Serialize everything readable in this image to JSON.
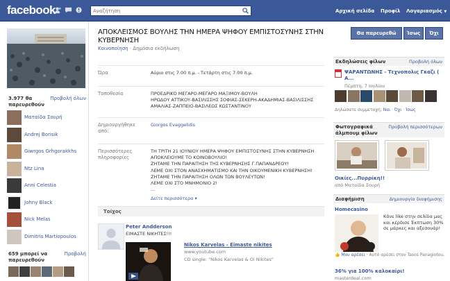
{
  "header": {
    "logo": "facebook",
    "search_placeholder": "Αναζήτηση",
    "nav_home": "Αρχική σελίδα",
    "nav_profile": "Προφίλ",
    "nav_account": "Λογαριασμός",
    "account_caret": "▼"
  },
  "left": {
    "attending_count": "3.977 θα παρευρεθούν",
    "see_all": "Προβολή όλων",
    "people": [
      "Ματαίδα Σουρή",
      "Andrej Borisik",
      "Giwrgos Grhgorakkhs",
      "Ntz Lina",
      "Anni Celestia",
      "Johny Black",
      "Nick Melas",
      "Dimitris Martiopoulos"
    ],
    "maybe_count": "659 μπορεί να παρευρεθούν",
    "maybe_see_all": "Προβολή"
  },
  "event": {
    "title": "ΑΠΟΚΛΕΙΣΜΟΣ ΒΟΥΛΗΣ ΤΗΝ ΗΜΕΡΑ ΨΗΦΟΥ ΕΜΠΙΣΤΟΣΥΝΗΣ ΣΤΗΝ ΚΥΒΕΡΝΗΣΗ",
    "share": "Κοινοποίηση",
    "privacy": " · Δημόσια εκδήλωση",
    "time_label": "Ώρα",
    "time_value": "Αύριο στις 7:00 π.μ. - Τετάρτη στις 7:00 π.μ.",
    "place_label": "Τοποθεσία",
    "place_value": "ΠΡΟΕΔΡΙΚΟ ΜΕΓΑΡΟ-ΜΕΓΑΡΟ ΜΑΞΙΜΟΥ-ΒΟΥΛΗ\nΗΡΩΔΟΥ ΑΤΤΙΚΟΥ-ΒΑΣΙΛΙΣΣΗΣ ΣΟΦΙΑΣ-ΣΕΚΕΡΗ-ΑΚΑΔΗΜΙΑΣ-ΒΑΣΙΛΙΣΣΗΣ\nΑΜΑΛΙΑΣ-ΖΑΠΠΕΙΟ-ΒΑΣΙΛΕΩΣ ΚΩΣΤΑΝΤΙΝΟΥ",
    "created_label": "Δημιουργήθηκε από:",
    "created_value": "Giorgos Evaggelidis",
    "more_label": "Περισσότερες πληροφορίες",
    "more_value": "ΤΗ ΤΡΙΤΗ 21 ΙΟΥΝΙΟΥ ΗΜΕΡΑ ΨΗΦΟΥ ΕΜΠΙΣΤΟΣΥΝΗΣ ΣΤΗΝ ΚΥΒΕΡΝΗΣΗ\nΑΠΟΚΛΕΙΟΥΜΕ ΤΟ ΚΟΙΝΟΒΟΥΛΙΟ!\nΖΗΤΑΜΕ ΤΗΝ ΠΑΡΑΙΤΗΣΗ ΤΗΣ ΚΥΒΕΡΝΗΣΗΣ Γ.ΠΑΠΑΝΔΡΕΟΥ!\nΛΕΜΕ ΟΧΙ ΣΤΟΝ ΑΝΑΣΧΗΜΑΤΙΣΜΟ ΚΑΙ ΤΗΝ ΟΙΚΟΥΜΕΝΙΚΗ ΚΥΒΕΡΝΗΣΗ!\nΖΗΤΑΜΕ ΤΗΝ ΠΑΡΑΙΤΗΣΗ ΟΛΩΝ ΤΩΝ ΒΟΥΛΕΥΤΩΝ!\nΛΕΜΕ ΟΧΙ ΣΤΟ ΜΝΗΜΟΝΙΟ 2!\n...",
    "see_more": "Δείτε περισσότερα ▾"
  },
  "wall": {
    "heading": "Τοίχος",
    "post_author": "Peter Andderson",
    "post_text": "ΕΙΜΑΣΤΕ ΝΙΚΗΤΕΣ!!!",
    "video_title": "Nikos Karvelas - Eimaste nikites",
    "video_url": "www.youtube.com",
    "video_desc": "CD single: \"Nikos Karvelas & Oi Nikites\""
  },
  "rsvp_buttons": {
    "attend": "Θα παρευρεθώ",
    "maybe": "Ίσως",
    "no": "Όχι"
  },
  "right": {
    "invites_heading": "Εκδηλώσεις φίλων",
    "invites_see_all": "Προβολή όλων",
    "invite_title": "ΨΑΡΑΝΤΩΝΗΣ - Τεχνοπολις Γκαζι ( Α...",
    "invite_date": "Πέμπτη, 7 Ιουλίου",
    "rsvp_question": "Δηλώσατε συμμετοχή; ",
    "rsvp_yes": "Ναι",
    "rsvp_sep1": " · ",
    "rsvp_no": "Όχι",
    "rsvp_sep2": " · ",
    "rsvp_maybe": "Ίσως",
    "albums_heading": "Φωτογραφικά άλμπουμ φίλων",
    "albums_see_more": "Προβολή περισσότερων",
    "album_title": "Οικίες...Πυρρίκη!!",
    "album_by": "από Ματαίδα Σουρή",
    "ads_heading": "Διαφήμιση",
    "ads_create": "Δημιουργία διαφήμισης",
    "ad_title": "Homecasino",
    "ad_body": "Κάνε like στην σελίδα μας και κέρδισε Έκπτωση 30% σε μάρκες και αξεσουάρ!",
    "ad_like_link": "Μου αρέσει",
    "ad_like_text": " · Αυτό αρέσει στον Tasos Panagiotou.",
    "ad2_title": "36% για 100% καλοκαίρι!",
    "ad2_url": "masterdeal.com"
  }
}
